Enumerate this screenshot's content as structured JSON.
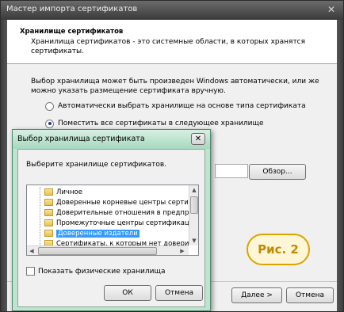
{
  "wizard": {
    "title": "Мастер импорта сертификатов",
    "close_glyph": "✕",
    "heading": "Хранилище сертификатов",
    "description": "Хранилища сертификатов - это системные области, в которых хранятся сертификаты.",
    "body_text": "Выбор хранилища может быть произведен Windows автоматически, или же можно указать размещение сертификата вручную.",
    "radio_auto_label": "Автоматически выбрать хранилище на основе типа сертификата",
    "radio_manual_label": "Поместить все сертификаты в следующее хранилище",
    "browse_label": "Обзор...",
    "next_label": "Далее >",
    "cancel_label": "Отмена",
    "selected_option": "manual"
  },
  "dialog": {
    "title": "Выбор хранилища сертификата",
    "close_glyph": "✕",
    "prompt": "Выберите хранилище сертификатов.",
    "stores": [
      "Личное",
      "Доверенные корневые центры сертиф",
      "Доверительные отношения в предпри",
      "Промежуточные центры сертификации",
      "Доверенные издатели",
      "Сертификаты, к которым нет довери"
    ],
    "selected_store": "Доверенные издатели",
    "show_physical_label": "Показать физические хранилища",
    "ok_label": "ОК",
    "cancel_label": "Отмена"
  },
  "annotation": {
    "label": "Рис. 2"
  },
  "colors": {
    "dialog_frame": "#bfe3cf",
    "selection": "#3399ff",
    "badge_border": "#d9a400",
    "badge_text": "#c08a00"
  }
}
